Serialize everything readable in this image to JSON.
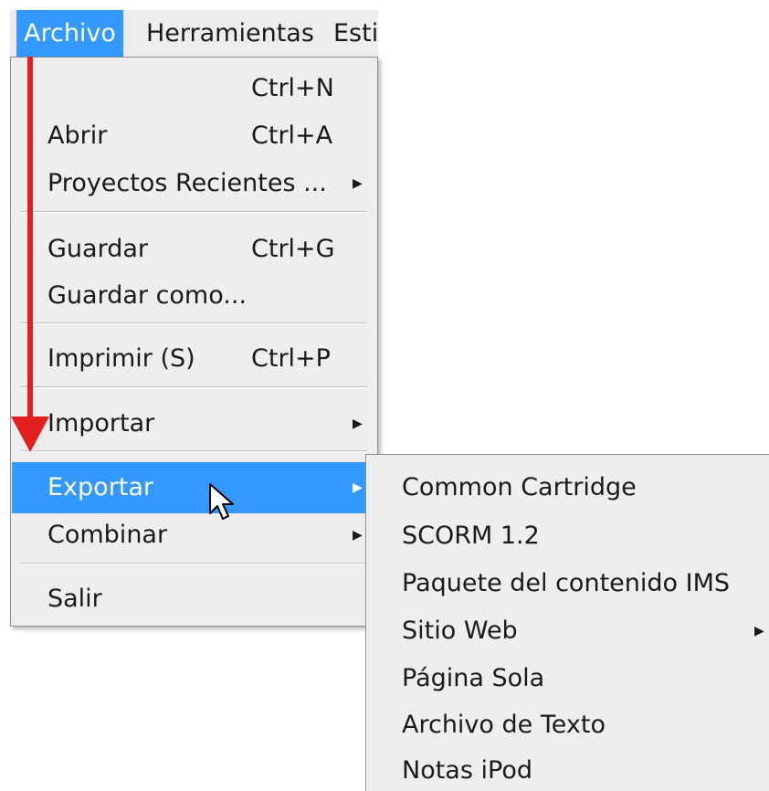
{
  "menubar": {
    "items": [
      {
        "label": "Archivo"
      },
      {
        "label": "Herramientas"
      },
      {
        "label": "Esti"
      }
    ]
  },
  "file_menu": {
    "items": [
      {
        "label": "",
        "shortcut": "Ctrl+N"
      },
      {
        "label": "Abrir",
        "shortcut": "Ctrl+A"
      },
      {
        "label": "Proyectos Recientes ...",
        "shortcut": ""
      },
      {
        "label": "Guardar",
        "shortcut": "Ctrl+G"
      },
      {
        "label": "Guardar como...",
        "shortcut": ""
      },
      {
        "label": "Imprimir (S)",
        "shortcut": "Ctrl+P"
      },
      {
        "label": "Importar",
        "shortcut": ""
      },
      {
        "label": "Exportar",
        "shortcut": ""
      },
      {
        "label": "Combinar",
        "shortcut": ""
      },
      {
        "label": "Salir",
        "shortcut": ""
      }
    ]
  },
  "export_submenu": {
    "items": [
      {
        "label": "Common Cartridge"
      },
      {
        "label": "SCORM 1.2"
      },
      {
        "label": "Paquete del contenido IMS"
      },
      {
        "label": "Sitio Web"
      },
      {
        "label": "Página Sola"
      },
      {
        "label": "Archivo de Texto"
      },
      {
        "label": "Notas iPod"
      }
    ]
  },
  "arrow_glyph": "▶",
  "colors": {
    "highlight": "#3399ff",
    "menu_bg": "#eeeeee",
    "annotation_arrow": "#e32020"
  },
  "icons": {
    "cursor": "mouse-pointer-icon",
    "submenu_arrow": "chevron-right-icon",
    "annotation": "red-down-arrow-icon"
  }
}
